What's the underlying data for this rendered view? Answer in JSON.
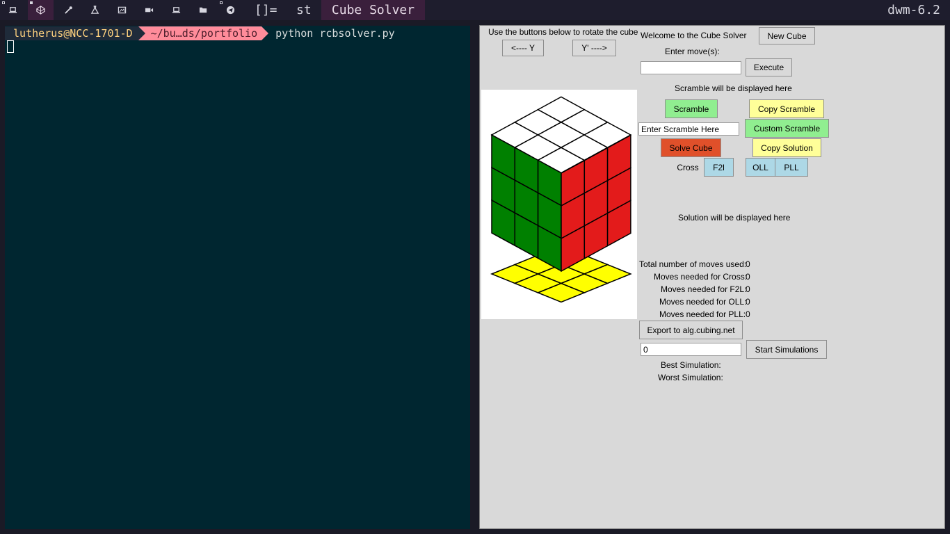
{
  "bar": {
    "tags": [
      {
        "icon": "laptop-icon"
      },
      {
        "icon": "codepen-icon"
      },
      {
        "icon": "eyedropper-icon"
      },
      {
        "icon": "flask-icon"
      },
      {
        "icon": "image-icon"
      },
      {
        "icon": "video-camera-icon"
      },
      {
        "icon": "laptop-icon"
      },
      {
        "icon": "folder-open-icon"
      },
      {
        "icon": "telegram-icon"
      }
    ],
    "layout_symbol": "[]=",
    "other_window": "st",
    "window_title": "Cube Solver",
    "status": "dwm-6.2",
    "colors": {
      "bar_bg": "#1e1d2d",
      "selected_bg": "#3a1f3c"
    }
  },
  "terminal": {
    "user_host": "lutherus@NCC-1701-D",
    "path": "~/bu…ds/portfolio",
    "command": "python rcbsolver.py",
    "colors": {
      "bg": "#002630",
      "path_bg": "#ff8c9a",
      "user_fg": "#ffd27f"
    }
  },
  "cube_solver": {
    "rotate_hint": "Use the buttons below to rotate the cube",
    "rotate_left_label": "<---- Y",
    "rotate_right_label": "Y' ---->",
    "welcome": "Welcome to the Cube Solver",
    "new_cube_label": "New Cube",
    "enter_moves_label": "Enter move(s):",
    "moves_input_value": "",
    "execute_label": "Execute",
    "scramble_display": "Scramble will be displayed here",
    "scramble_label": "Scramble",
    "copy_scramble_label": "Copy Scramble",
    "scramble_input_value": "Enter Scramble Here",
    "custom_scramble_label": "Custom Scramble",
    "solve_cube_label": "Solve Cube",
    "copy_solution_label": "Copy Solution",
    "step_cross_label": "Cross",
    "step_f2l_label": "F2l",
    "step_oll_label": "OLL",
    "step_pll_label": "PLL",
    "solution_display": "Solution will be displayed here",
    "stats": {
      "total_label": "Total number of moves used:",
      "total_value": "0",
      "cross_label": "Moves needed for Cross:",
      "cross_value": "0",
      "f2l_label": "Moves needed for F2L:",
      "f2l_value": "0",
      "oll_label": "Moves needed for OLL:",
      "oll_value": "0",
      "pll_label": "Moves needed for PLL:",
      "pll_value": "0"
    },
    "export_label": "Export to alg.cubing.net",
    "simulations_input_value": "0",
    "start_simulations_label": "Start Simulations",
    "best_simulation_label": "Best Simulation:",
    "worst_simulation_label": "Worst Simulation:",
    "cube_faces": {
      "top": "#ffffff",
      "left": "#008000",
      "right": "#e31b1b",
      "bottom": "#ffff00"
    },
    "colors": {
      "scramble_bg": "#90ee90",
      "copy_bg": "#ffff99",
      "solve_bg": "#e0502a",
      "step_bg": "#add8e6",
      "window_bg": "#d9d9d9"
    }
  }
}
